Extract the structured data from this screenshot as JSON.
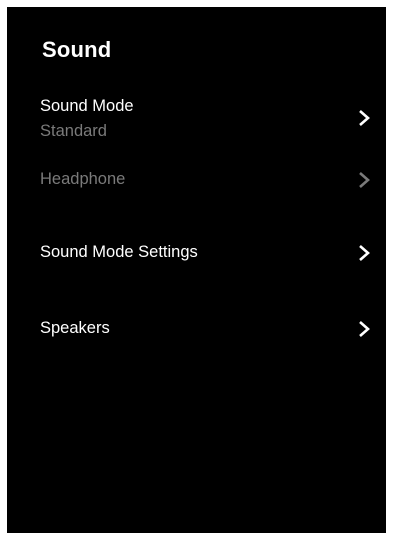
{
  "screen": {
    "title": "Sound"
  },
  "items": [
    {
      "label": "Sound Mode",
      "value": "Standard",
      "icon": "chevron-right-icon"
    },
    {
      "label": "Headphone",
      "disabled": true,
      "icon": "chevron-right-icon"
    },
    {
      "label": "Sound Mode Settings",
      "icon": "chevron-right-icon"
    },
    {
      "label": "Speakers",
      "icon": "chevron-right-icon"
    }
  ],
  "colors": {
    "background": "#000000",
    "text": "#ffffff",
    "disabled_text": "#7a7a7a"
  }
}
